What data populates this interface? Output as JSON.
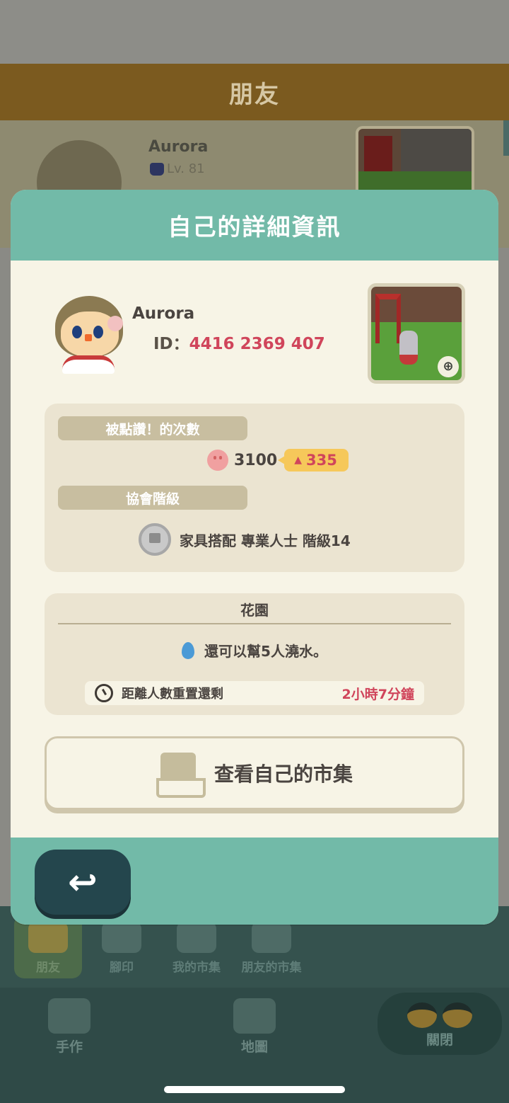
{
  "background": {
    "header_title": "朋友",
    "friend": {
      "name": "Aurora",
      "level": "Lv. 81"
    },
    "tabs": [
      {
        "label": "朋友"
      },
      {
        "label": "腳印"
      },
      {
        "label": "我的市集"
      },
      {
        "label": "朋友的市集"
      }
    ],
    "nav": {
      "craft": "手作",
      "map": "地圖",
      "close": "關閉"
    }
  },
  "dialog": {
    "title": "自己的詳細資訊",
    "profile": {
      "name": "Aurora",
      "id_label": "ID：",
      "id_value": "4416 2369 407"
    },
    "likes": {
      "label": "被點讚！的次數",
      "count": "3100",
      "delta": "335"
    },
    "rank": {
      "label": "協會階級",
      "text": "家具搭配 專業人士 階級14"
    },
    "garden": {
      "title": "花園",
      "water_text": "還可以幫5人澆水。",
      "reset_label": "距離人數重置還剩",
      "reset_time": "2小時7分鐘"
    },
    "market_button": "查看自己的市集"
  },
  "icons": {
    "back": "↩",
    "zoom": "⊕",
    "delta_up": "▲"
  },
  "colors": {
    "header_teal": "#72baa8",
    "accent_red": "#d0455b",
    "delta_yellow": "#f6c85a",
    "card_beige": "#ebe4d1"
  }
}
